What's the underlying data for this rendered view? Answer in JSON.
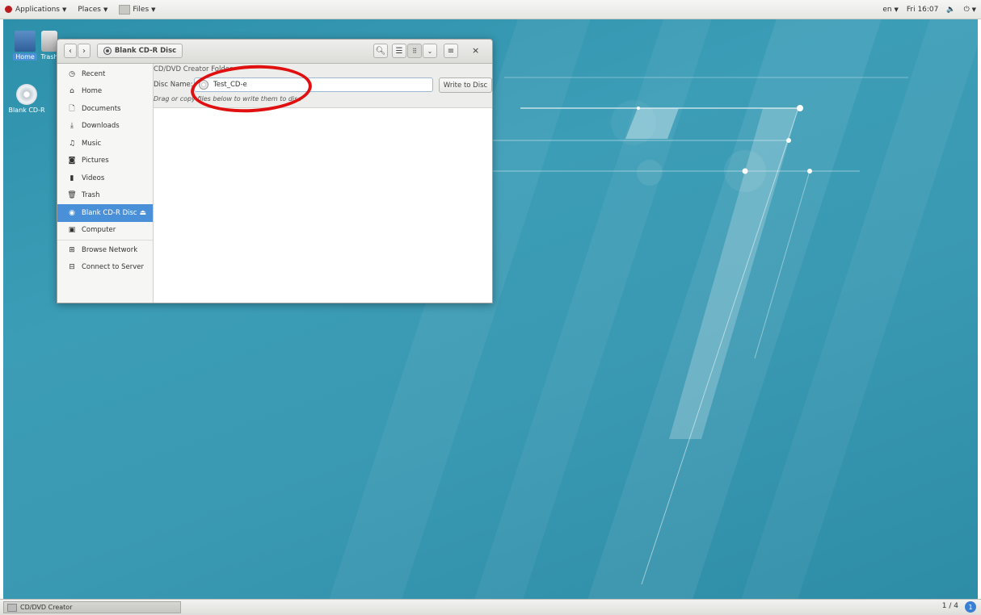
{
  "top_panel": {
    "applications": "Applications",
    "places": "Places",
    "files": "Files",
    "language": "en",
    "clock": "Fri 16:07"
  },
  "desktop": {
    "icons": [
      {
        "label": "Home",
        "icon": "home-folder-icon"
      },
      {
        "label": "Trash",
        "icon": "trash-icon"
      },
      {
        "label": "Blank CD-R",
        "icon": "cd-disc-icon"
      }
    ]
  },
  "window": {
    "path_button": "Blank CD-R Disc",
    "sidebar": [
      {
        "label": "Recent",
        "icon": "clock-icon"
      },
      {
        "label": "Home",
        "icon": "home-icon"
      },
      {
        "label": "Documents",
        "icon": "document-icon"
      },
      {
        "label": "Downloads",
        "icon": "download-icon"
      },
      {
        "label": "Music",
        "icon": "music-icon"
      },
      {
        "label": "Pictures",
        "icon": "camera-icon"
      },
      {
        "label": "Videos",
        "icon": "video-icon"
      },
      {
        "label": "Trash",
        "icon": "trash-icon"
      },
      {
        "label": "Blank CD-R Disc",
        "icon": "disc-icon",
        "active": true
      },
      {
        "label": "Computer",
        "icon": "computer-icon"
      },
      {
        "label": "Browse Network",
        "icon": "network-icon"
      },
      {
        "label": "Connect to Server",
        "icon": "server-icon"
      }
    ],
    "info_bar": {
      "title": "CD/DVD Creator Folder",
      "disc_name_label": "Disc Name:",
      "disc_name_value": "Test_CD-e",
      "write_button": "Write to Disc",
      "hint": "Drag or copy files below to write them to disc"
    }
  },
  "bottom_panel": {
    "task": "CD/DVD Creator",
    "workspace": "1 / 4",
    "notification_count": "1"
  },
  "colors": {
    "desktop_bg": "#3a99b3",
    "selection": "#4a90d9",
    "annotation": "#e01010"
  }
}
